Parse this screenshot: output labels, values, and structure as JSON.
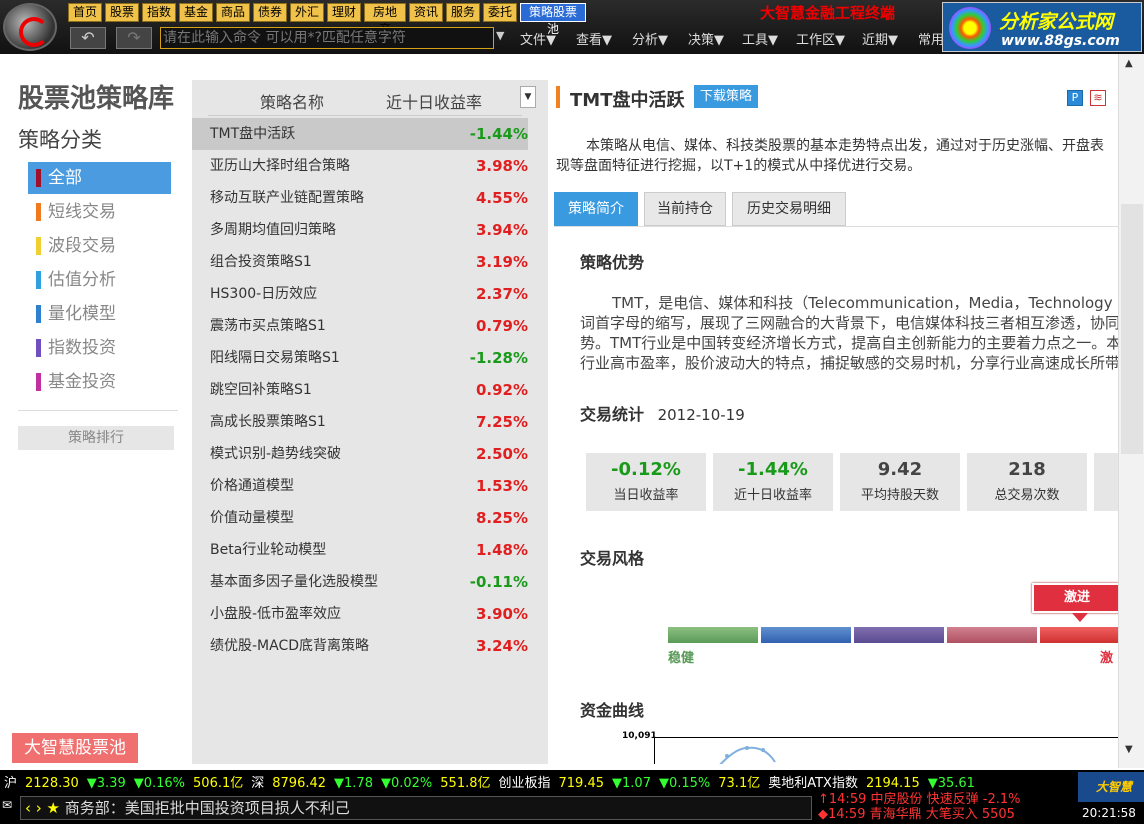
{
  "toolbar": {
    "menus": [
      "首页",
      "股票",
      "指数",
      "基金",
      "商品",
      "债券",
      "外汇",
      "理财",
      "房地产",
      "资讯",
      "服务",
      "委托",
      "策略股票池"
    ],
    "command_placeholder": "请在此输入命令   可以用*?匹配任意字符",
    "menu2": [
      "文件▼",
      "查看▼",
      "分析▼",
      "决策▼",
      "工具▼",
      "工作区▼",
      "近期▼",
      "常用"
    ],
    "app_title": "大智慧金融工程终端",
    "brand_title": "分析家公式网",
    "brand_url": "www.88gs.com"
  },
  "left": {
    "title": "股票池策略库",
    "subtitle": "策略分类",
    "categories": [
      {
        "label": "全部",
        "color": "#a0102a"
      },
      {
        "label": "短线交易",
        "color": "#f07a20"
      },
      {
        "label": "波段交易",
        "color": "#f0d030"
      },
      {
        "label": "估值分析",
        "color": "#30a0e0"
      },
      {
        "label": "量化模型",
        "color": "#3080d0"
      },
      {
        "label": "指数投资",
        "color": "#7050c0"
      },
      {
        "label": "基金投资",
        "color": "#c030a0"
      }
    ],
    "rank_button": "策略排行",
    "bottom_button": "大智慧股票池"
  },
  "list": {
    "col_name": "策略名称",
    "col_return": "近十日收益率",
    "dropdown_glyph": "▼",
    "rows": [
      {
        "name": "TMT盘中活跃",
        "ret": "-1.44%"
      },
      {
        "name": "亚历山大择时组合策略",
        "ret": "3.98%"
      },
      {
        "name": "移动互联产业链配置策略",
        "ret": "4.55%"
      },
      {
        "name": "多周期均值回归策略",
        "ret": "3.94%"
      },
      {
        "name": "组合投资策略S1",
        "ret": "3.19%"
      },
      {
        "name": "HS300-日历效应",
        "ret": "2.37%"
      },
      {
        "name": "震荡市买点策略S1",
        "ret": "0.79%"
      },
      {
        "name": "阳线隔日交易策略S1",
        "ret": "-1.28%"
      },
      {
        "name": "跳空回补策略S1",
        "ret": "0.92%"
      },
      {
        "name": "高成长股票策略S1",
        "ret": "7.25%"
      },
      {
        "name": "模式识别-趋势线突破",
        "ret": "2.50%"
      },
      {
        "name": "价格通道模型",
        "ret": "1.53%"
      },
      {
        "name": "价值动量模型",
        "ret": "8.25%"
      },
      {
        "name": "Beta行业轮动模型",
        "ret": "1.48%"
      },
      {
        "name": "基本面多因子量化选股模型",
        "ret": "-0.11%"
      },
      {
        "name": "小盘股-低市盈率效应",
        "ret": "3.90%"
      },
      {
        "name": "绩优股-MACD底背离策略",
        "ret": "3.24%"
      }
    ]
  },
  "detail": {
    "name": "TMT盘中活跃",
    "download": "下载策略",
    "desc": "本策略从电信、媒体、科技类股票的基本走势特点出发，通过对于历史涨幅、开盘表现等盘面特征进行挖掘，以T+1的模式从中择优进行交易。",
    "tabs": [
      "策略简介",
      "当前持仓",
      "历史交易明细"
    ],
    "adv_title": "策略优势",
    "adv_lines": [
      "TMT，是电信、媒体和科技（Telecommunication，Media，Technology",
      "词首字母的缩写，展现了三网融合的大背景下，电信媒体科技三者相互渗透，协同",
      "势。TMT行业是中国转变经济增长方式，提高自主创新能力的主要着力点之一。本",
      "行业高市盈率，股价波动大的特点，捕捉敏感的交易时机，分享行业高速成长所带"
    ],
    "stats_title": "交易统计",
    "stats_date": "2012-10-19",
    "stats": [
      {
        "value": "-0.12%",
        "label": "当日收益率"
      },
      {
        "value": "-1.44%",
        "label": "近十日收益率"
      },
      {
        "value": "9.42",
        "label": "平均持股天数"
      },
      {
        "value": "218",
        "label": "总交易次数"
      }
    ],
    "style_title": "交易风格",
    "style_tag": "激进",
    "style_left": "稳健",
    "style_right": "激",
    "curve_title": "资金曲线",
    "curve_ytick": "10,091"
  },
  "status": {
    "items": [
      {
        "t": "沪",
        "c": "wh"
      },
      {
        "t": "2128.30",
        "c": "yl"
      },
      {
        "t": "▼3.39",
        "c": "dn"
      },
      {
        "t": "▼0.16%",
        "c": "dn"
      },
      {
        "t": "506.1亿",
        "c": "yl"
      },
      {
        "t": "深",
        "c": "wh"
      },
      {
        "t": "8796.42",
        "c": "yl"
      },
      {
        "t": "▼1.78",
        "c": "dn"
      },
      {
        "t": "▼0.02%",
        "c": "dn"
      },
      {
        "t": "551.8亿",
        "c": "yl"
      },
      {
        "t": "创业板指",
        "c": "wh"
      },
      {
        "t": "719.45",
        "c": "yl"
      },
      {
        "t": "▼1.07",
        "c": "dn"
      },
      {
        "t": "▼0.15%",
        "c": "dn"
      },
      {
        "t": "73.1亿",
        "c": "yl"
      },
      {
        "t": "奥地利ATX指数",
        "c": "wh"
      },
      {
        "t": "2194.15",
        "c": "yl"
      },
      {
        "t": "▼35.61",
        "c": "dn"
      }
    ],
    "ticker": "商务部：美国拒批中国投资项目损人不利己",
    "news1": "↑14:59 中房股份 快速反弹 -2.1%",
    "news2": "◆14:59 青海华鼎 大笔买入 5505",
    "clock": "20:21:58",
    "mini": "大智慧"
  }
}
